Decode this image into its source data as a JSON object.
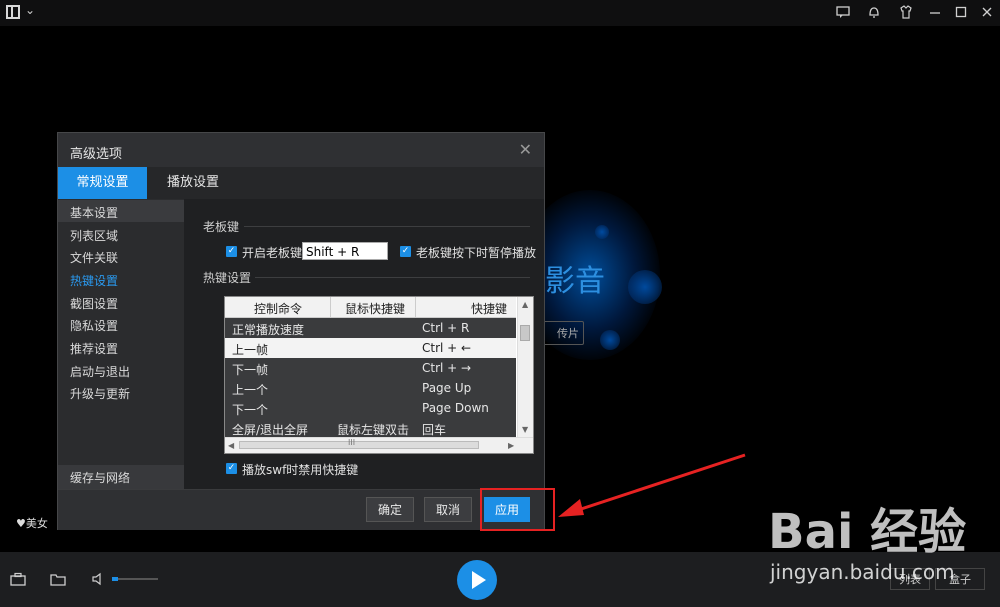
{
  "titlebar": {
    "dropdown_glyph": "⌄"
  },
  "player": {
    "brand_glyph": "影音",
    "upload_label": "传片",
    "beauty_label": "美女"
  },
  "dialog": {
    "title": "高级选项",
    "close_glyph": "✕",
    "tabs": [
      {
        "label": "常规设置",
        "active": true
      },
      {
        "label": "播放设置",
        "active": false
      }
    ],
    "sidebar": {
      "items": [
        "基本设置",
        "列表区域",
        "文件关联",
        "热键设置",
        "截图设置",
        "隐私设置",
        "推荐设置",
        "启动与退出",
        "升级与更新"
      ],
      "active_item": "热键设置",
      "bottom_item": "缓存与网络"
    },
    "boss_key": {
      "section_title": "老板键",
      "enable_label": "开启老板键",
      "enable_checked": true,
      "key_value": "Shift + R",
      "pause_label": "老板键按下时暂停播放",
      "pause_checked": true
    },
    "hotkeys": {
      "section_title": "热键设置",
      "columns": [
        "控制命令",
        "鼠标快捷键",
        "快捷键"
      ],
      "rows": [
        [
          "正常播放速度",
          "",
          "Ctrl + R"
        ],
        [
          "上一帧",
          "",
          "Ctrl + ←"
        ],
        [
          "下一帧",
          "",
          "Ctrl + →"
        ],
        [
          "上一个",
          "",
          "Page Up"
        ],
        [
          "下一个",
          "",
          "Page Down"
        ],
        [
          "全屏/退出全屏",
          "鼠标左键双击",
          "回车"
        ]
      ],
      "selected_row": 1,
      "hscroll_glyph": "III"
    },
    "swf_label": "播放swf时禁用快捷键",
    "swf_checked": true,
    "buttons": {
      "ok": "确定",
      "cancel": "取消",
      "apply": "应用"
    }
  },
  "bottombar": {
    "list_label": "列表",
    "box_label": "盒子"
  },
  "watermark": {
    "line1": "Bai 经验",
    "line2": "jingyan.baidu.com"
  },
  "colors": {
    "accent": "#1c8fe6",
    "annotation": "#e62222"
  }
}
